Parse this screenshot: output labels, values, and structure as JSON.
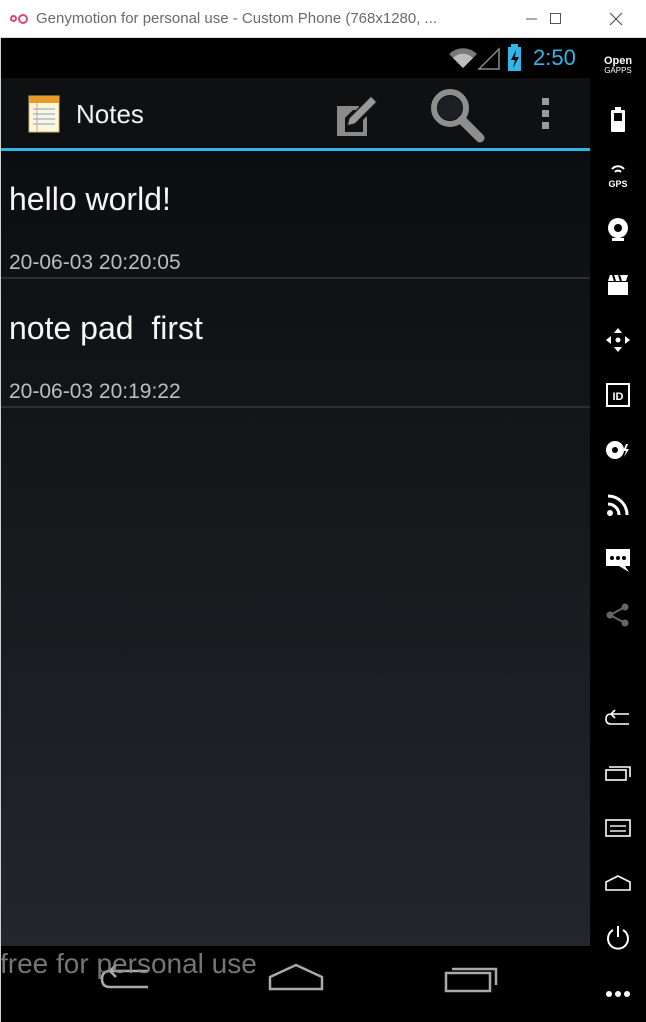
{
  "window": {
    "title": "Genymotion for personal use - Custom Phone (768x1280, ...",
    "logo_icon": "genymotion-logo-icon",
    "controls": [
      "minimize-icon",
      "maximize-icon",
      "close-icon"
    ]
  },
  "status_bar": {
    "time": "2:50",
    "icons": [
      "wifi-icon",
      "cell-signal-icon",
      "battery-charging-icon"
    ],
    "accent_color": "#33b5e5"
  },
  "action_bar": {
    "app_icon": "notepad-icon",
    "title": "Notes",
    "actions": [
      "new-note-icon",
      "search-icon",
      "overflow-menu-icon"
    ]
  },
  "notes": [
    {
      "title": "hello world!",
      "date": "20-06-03 20:20:05"
    },
    {
      "title": "note pad  first",
      "date": "20-06-03 20:19:22"
    }
  ],
  "navigation_bar": {
    "buttons": [
      "back-icon",
      "home-icon",
      "recents-icon"
    ]
  },
  "watermark": "free for personal use",
  "side_toolbar": {
    "opengapps_label_top": "Open",
    "opengapps_label_bottom": "GAPPS",
    "gps_label": "GPS",
    "id_label": "ID",
    "buttons": [
      "battery-icon",
      "gps-icon",
      "webcam-icon",
      "capture-icon",
      "dpad-icon",
      "identifiers-icon",
      "disk-io-icon",
      "network-icon",
      "sms-icon",
      "share-icon",
      "back-icon",
      "recent-apps-icon",
      "menu-icon",
      "home-icon",
      "power-icon",
      "more-icon"
    ]
  }
}
